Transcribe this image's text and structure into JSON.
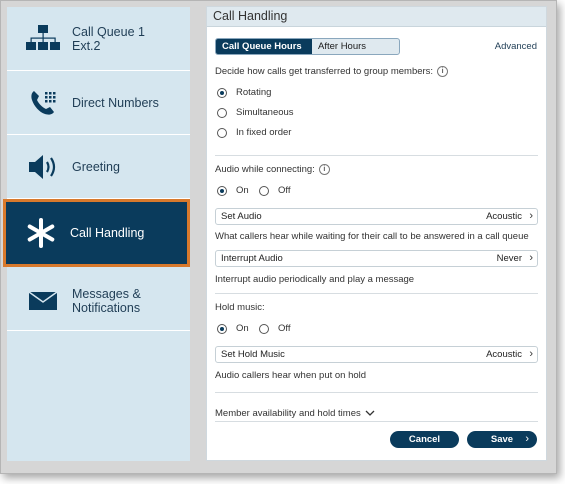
{
  "sidebar": {
    "items": [
      {
        "label": "Call Queue 1\nExt.2",
        "line1": "Call Queue 1",
        "line2": "Ext.2",
        "icon": "org-chart-icon"
      },
      {
        "label": "Direct Numbers",
        "icon": "phone-icon"
      },
      {
        "label": "Greeting",
        "icon": "speaker-icon"
      },
      {
        "label": "Call Handling",
        "icon": "asterisk-icon",
        "active": true
      },
      {
        "line1": "Messages &",
        "line2": "Notifications",
        "icon": "envelope-icon"
      }
    ]
  },
  "panel": {
    "title": "Call Handling",
    "tabs": [
      {
        "label": "Call Queue Hours",
        "active": true
      },
      {
        "label": "After Hours",
        "active": false
      }
    ],
    "advanced_link": "Advanced",
    "transfer_prompt": "Decide how calls get transferred to group members:",
    "transfer_options": [
      {
        "label": "Rotating",
        "checked": true
      },
      {
        "label": "Simultaneous",
        "checked": false
      },
      {
        "label": "In fixed order",
        "checked": false
      }
    ],
    "audio_connecting": {
      "label": "Audio while connecting:",
      "on_label": "On",
      "off_label": "Off",
      "value": "On"
    },
    "set_audio": {
      "label": "Set Audio",
      "value": "Acoustic"
    },
    "set_audio_help": "What callers hear while waiting for their call to be answered in a call queue",
    "interrupt_audio": {
      "label": "Interrupt Audio",
      "value": "Never"
    },
    "interrupt_help": "Interrupt audio periodically and play a message",
    "hold_music": {
      "label": "Hold music:",
      "on_label": "On",
      "off_label": "Off",
      "value": "On"
    },
    "set_hold_music": {
      "label": "Set Hold Music",
      "value": "Acoustic"
    },
    "hold_help": "Audio callers hear when put on hold",
    "member_availability": "Member availability and hold times",
    "cancel_label": "Cancel",
    "save_label": "Save"
  },
  "colors": {
    "nav_bg": "#d5e6ef",
    "active_bg": "#0a3b5c",
    "active_outline": "#d8792c",
    "primary": "#0a3b5c"
  }
}
